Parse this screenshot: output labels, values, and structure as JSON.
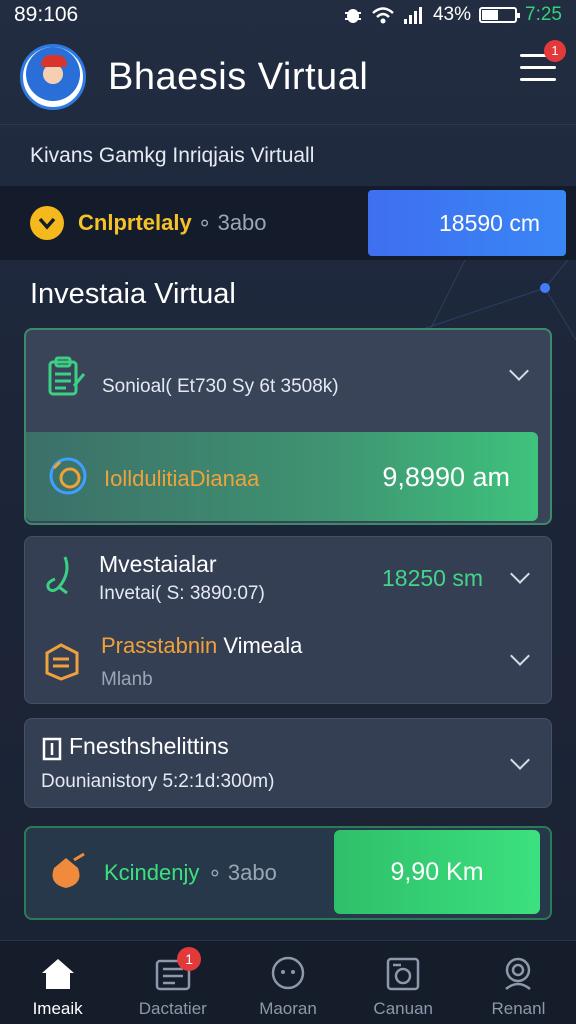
{
  "status_bar": {
    "time": "89:106",
    "battery_percent": "43%",
    "clock_right": "7:25"
  },
  "header": {
    "app_title": "Bhaesis Virtual",
    "notification_count": "1"
  },
  "subtitle": "Kivans Gamkg Inriqjais Virtuall",
  "balance": {
    "label": "Cnlprtelaly",
    "sub_label": "∘ 3abo",
    "amount": "18590 cm"
  },
  "section_title": "Investaia Virtual",
  "cards": {
    "card1": {
      "row1_text": "Sonioal( Et730 Sy 6t 3508k)",
      "row2_label": "IolldulitiaDianaa",
      "row2_value": "9,8990 am"
    },
    "card2": {
      "row1_title": "Mvestaialar",
      "row1_sub": "Invetai( S: 3890:07)",
      "row1_value": "18250 sm",
      "row2_title": "Prasstabnin",
      "row2_title_rest": "Vimeala",
      "row2_sub": "Mlanb"
    },
    "card3": {
      "title": "Fnesthshelittins",
      "sub": "Dounianistory 5:2:1d:300m)"
    },
    "card4": {
      "label": "Kcindenjy",
      "sub_label": "∘ 3abo",
      "button": "9,90 Km"
    }
  },
  "bottom_nav": [
    {
      "label": "Imeaik",
      "icon": "home-icon",
      "active": true
    },
    {
      "label": "Dactatier",
      "icon": "document-icon",
      "badge": "1"
    },
    {
      "label": "Maoran",
      "icon": "chat-icon"
    },
    {
      "label": "Canuan",
      "icon": "camera-icon"
    },
    {
      "label": "Renanl",
      "icon": "profile-icon"
    }
  ],
  "colors": {
    "background": "#1c2538",
    "accent_blue": "#3e6ff0",
    "accent_green": "#3ce17f",
    "accent_orange": "#f0a23a",
    "coin_yellow": "#f5b91e",
    "badge_red": "#e23a3a"
  }
}
